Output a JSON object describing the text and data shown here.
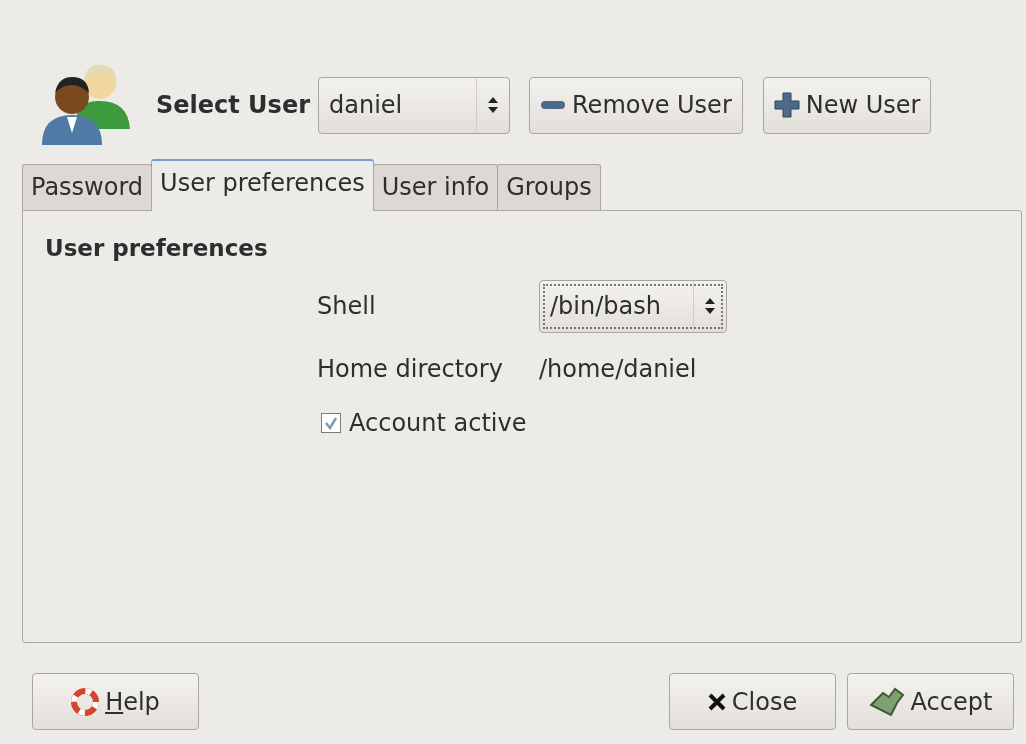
{
  "header": {
    "label": "Select User",
    "user_select": {
      "value": "daniel"
    },
    "buttons": [
      {
        "kind": "remove",
        "label": "Remove User"
      },
      {
        "kind": "new",
        "label": "New User"
      }
    ]
  },
  "tabs": [
    {
      "label": "Password",
      "selected": false
    },
    {
      "label": "User preferences",
      "selected": true
    },
    {
      "label": "User info",
      "selected": false
    },
    {
      "label": "Groups",
      "selected": false
    }
  ],
  "panel": {
    "title": "User preferences",
    "shell": {
      "label": "Shell",
      "value": "/bin/bash"
    },
    "home": {
      "label": "Home directory",
      "value": "/home/daniel"
    },
    "account_active": {
      "label": "Account active",
      "checked": true
    }
  },
  "footer": {
    "buttons": [
      {
        "kind": "help",
        "label": "Help",
        "mnemonic": true
      },
      {
        "kind": "close",
        "label": "Close",
        "mnemonic": false
      },
      {
        "kind": "accept",
        "label": "Accept",
        "mnemonic": false
      }
    ]
  }
}
